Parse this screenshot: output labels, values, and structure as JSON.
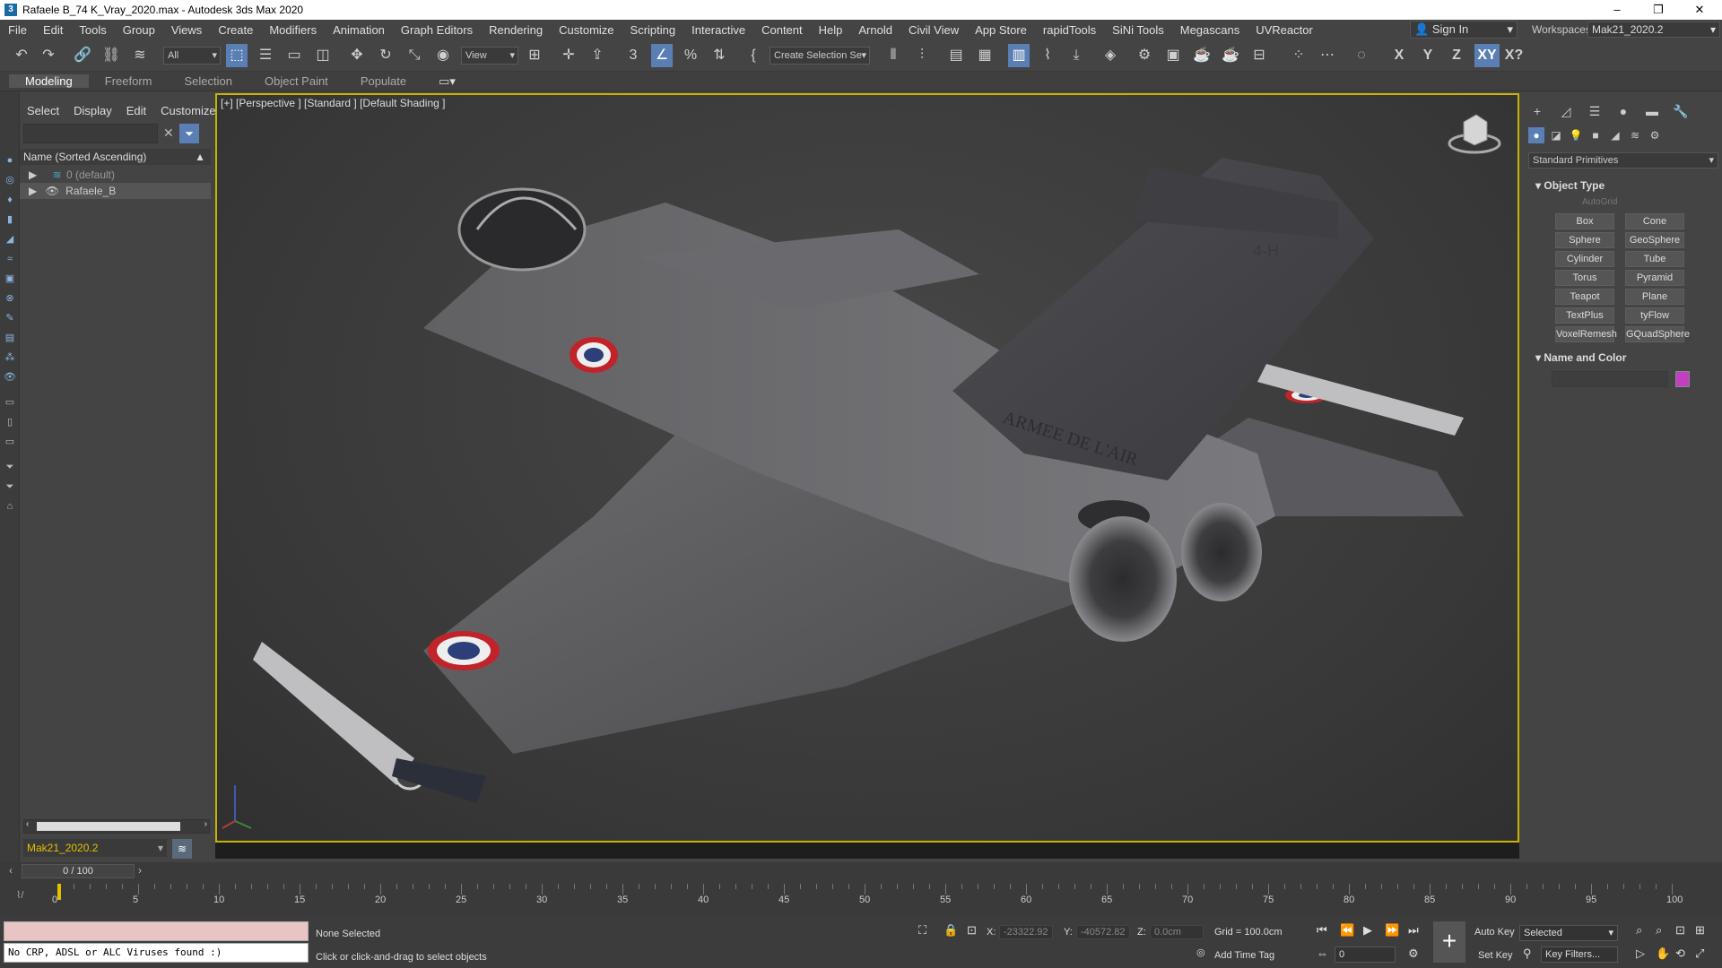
{
  "window": {
    "title": "Rafaele B_74 K_Vray_2020.max - Autodesk 3ds Max 2020",
    "controls": [
      "–",
      "❐",
      "✕"
    ]
  },
  "menubar": {
    "items": [
      "File",
      "Edit",
      "Tools",
      "Group",
      "Views",
      "Create",
      "Modifiers",
      "Animation",
      "Graph Editors",
      "Rendering",
      "Customize",
      "Scripting",
      "Interactive",
      "Content",
      "Help",
      "Arnold",
      "Civil View",
      "App Store",
      "rapidTools",
      "SiNi Tools",
      "Megascans",
      "UVReactor"
    ],
    "signin": "Sign In",
    "workspaces_label": "Workspaces:",
    "workspace_value": "Mak21_2020.2"
  },
  "toolbar": {
    "selection_filter": "All",
    "ref_coord": "View",
    "named_selection": "Create Selection Se",
    "axis_x": "X",
    "axis_y": "Y",
    "axis_z": "Z",
    "axis_xy": "XY",
    "axis_xq": "X?"
  },
  "ribbon": {
    "tabs": [
      "Modeling",
      "Freeform",
      "Selection",
      "Object Paint",
      "Populate"
    ]
  },
  "scene_explorer": {
    "menu": [
      "Select",
      "Display",
      "Edit",
      "Customize"
    ],
    "column_header": "Name (Sorted Ascending)",
    "rows": [
      "0 (default)",
      "Rafaele_B"
    ],
    "layer": "Mak21_2020.2"
  },
  "viewport": {
    "label": "[+] [Perspective ] [Standard ] [Default Shading ]",
    "tail_text": "ARMEE DE L'AIR",
    "tail_code": "4-H"
  },
  "command_panel": {
    "dropdown": "Standard Primitives",
    "object_type_title": "Object Type",
    "autogrid": "AutoGrid",
    "primitives": [
      "Box",
      "Cone",
      "Sphere",
      "GeoSphere",
      "Cylinder",
      "Tube",
      "Torus",
      "Pyramid",
      "Teapot",
      "Plane",
      "TextPlus",
      "tyFlow",
      "VoxelRemesh",
      "GQuadSphere"
    ],
    "name_color_title": "Name and Color",
    "color": "#c040c0"
  },
  "timeline": {
    "frame": "0 / 100",
    "ticks": [
      0,
      5,
      10,
      15,
      20,
      25,
      30,
      35,
      40,
      45,
      50,
      55,
      60,
      65,
      70,
      75,
      80,
      85,
      90,
      95,
      100
    ]
  },
  "status": {
    "script_output": "No CRP, ADSL or ALC Viruses found :)",
    "selection": "None Selected",
    "prompt": "Click or click-and-drag to select objects",
    "x_label": "X:",
    "x_value": "-23322.92",
    "y_label": "Y:",
    "y_value": "-40572.82",
    "z_label": "Z:",
    "z_value": "0.0cm",
    "grid": "Grid = 100.0cm",
    "add_time_tag": "Add Time Tag",
    "auto_key": "Auto Key",
    "set_key": "Set Key",
    "key_mode": "Selected",
    "key_filters": "Key Filters...",
    "current_frame": "0"
  }
}
